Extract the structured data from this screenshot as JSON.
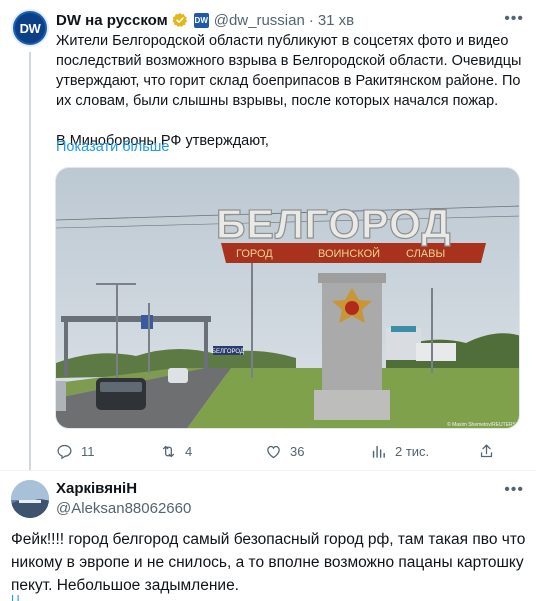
{
  "tweet": {
    "author_name": "DW на русском",
    "author_handle": "@dw_russian",
    "separator": "·",
    "time": "31 хв",
    "avatar_text": "DW",
    "affiliation_badge": "DW",
    "text_paragraph_1": "Жители Белгородской области публикуют в соцсетях фото и видео последствий возможного взрыва в Белгородской области. Очевидцы утверждают, что горит склад боеприпасов в Ракитянском районе. По их словам, были слышны взрывы, после которых начался пожар.",
    "text_paragraph_2": "В Минобороны РФ утверждают,",
    "show_more": "Показати більше",
    "image": {
      "sign_main": "БЕЛГОРОД",
      "sign_sub_1": "ГОРОД",
      "sign_sub_2": "ВОИНСКОЙ",
      "sign_sub_3": "СЛАВЫ",
      "road_sign": "БЕЛГОРОД",
      "credit": "© Maxim Shemetov/REUTERS"
    },
    "actions": {
      "replies": "11",
      "retweets": "4",
      "likes": "36",
      "views": "2 тис."
    }
  },
  "reply": {
    "author_name": "ХарківяніН",
    "author_handle": "@Aleksan88062660",
    "text": "Фейк!!!! город белгород самый безопасный город рф, там такая пво что никому в эвропе и не снилось, а то вполне возможно пацаны картошку пекут. Небольшое задымление."
  },
  "colors": {
    "link": "#1d9bf0",
    "secondary_text": "#536471",
    "verified_gold": "#e2b719",
    "dw_blue": "#1e5aa8"
  },
  "icons": [
    "more-icon",
    "verified-badge-icon",
    "affiliation-badge-icon",
    "reply-icon",
    "retweet-icon",
    "like-icon",
    "views-icon",
    "share-icon"
  ]
}
